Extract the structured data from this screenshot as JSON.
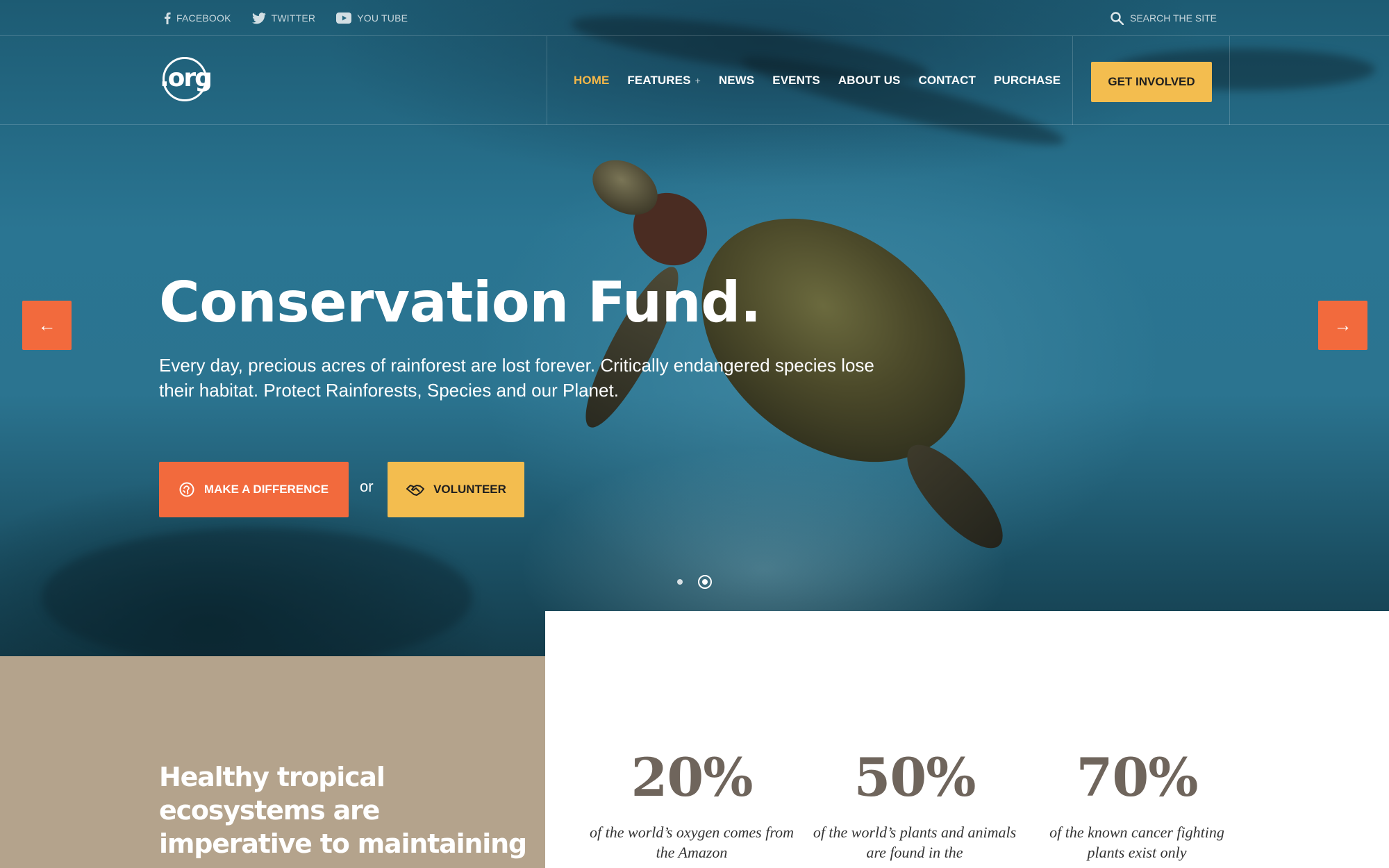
{
  "topbar": {
    "social": [
      {
        "label": "FACEBOOK",
        "icon": "facebook-icon"
      },
      {
        "label": "TWITTER",
        "icon": "twitter-icon"
      },
      {
        "label": "YOU TUBE",
        "icon": "youtube-icon"
      }
    ],
    "search_label": "SEARCH THE SITE"
  },
  "nav": {
    "logo_text": ".org",
    "items": [
      {
        "label": "HOME",
        "active": true
      },
      {
        "label": "FEATURES",
        "has_submenu": true,
        "submenu_marker": "+"
      },
      {
        "label": "NEWS"
      },
      {
        "label": "EVENTS"
      },
      {
        "label": "ABOUT US"
      },
      {
        "label": "CONTACT"
      },
      {
        "label": "PURCHASE"
      }
    ],
    "cta_label": "GET INVOLVED"
  },
  "hero": {
    "title": "Conservation Fund.",
    "text": "Every day, precious acres of rainforest are lost forever. Critically endangered species lose their habitat. Protect Rainforests, Species and our Planet.",
    "primary_button": "MAKE A DIFFERENCE",
    "separator": "or",
    "secondary_button": "VOLUNTEER",
    "prev_arrow": "←",
    "next_arrow": "→",
    "slides": {
      "count": 2,
      "active": 2
    }
  },
  "info": {
    "heading": "Healthy tropical ecosystems are imperative to maintaining",
    "stats": [
      {
        "value": "20%",
        "description": "of the world’s oxygen comes from the Amazon"
      },
      {
        "value": "50%",
        "description": "of the world’s plants and animals are found in the"
      },
      {
        "value": "70%",
        "description": "of the known cancer fighting plants exist only"
      }
    ]
  },
  "colors": {
    "accent_orange": "#f26a3d",
    "accent_yellow": "#f3bd4f",
    "active_nav": "#f3b749",
    "tan_panel": "#b4a38c",
    "stat_text": "#6f655c"
  }
}
